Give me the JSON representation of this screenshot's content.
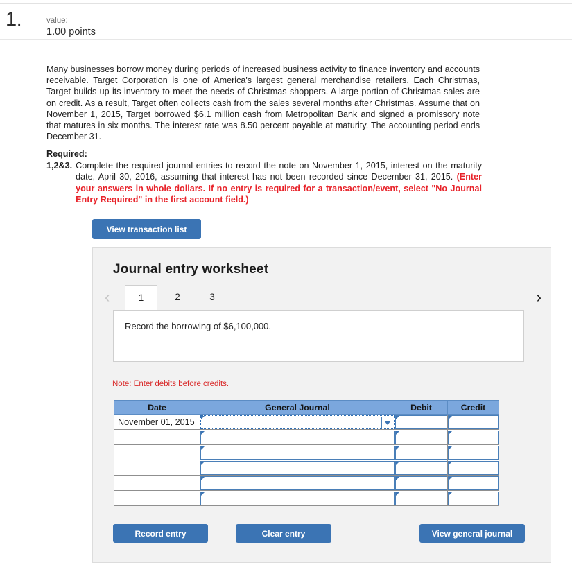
{
  "question": {
    "number": "1.",
    "value_label": "value:",
    "points": "1.00 points"
  },
  "prose": "Many businesses borrow money during periods of increased business activity to finance inventory and accounts receivable. Target Corporation is one of America's largest general merchandise retailers. Each Christmas, Target builds up its inventory to meet the needs of Christmas shoppers. A large portion of Christmas sales are on credit. As a result, Target often collects cash from the sales several months after Christmas. Assume that on November 1, 2015, Target borrowed $6.1 million cash from Metropolitan Bank and signed a promissory note that matures in six months. The interest rate was 8.50 percent payable at maturity. The accounting period ends December 31.",
  "required": {
    "title": "Required:",
    "item_number": "1,2&3.",
    "item_text": "Complete the required journal entries to record the note on November 1, 2015, interest on the maturity date, April 30, 2016, assuming that interest has not been recorded since December 31, 2015. ",
    "item_emphasis": "(Enter your answers in whole dollars. If no entry is required for a transaction/event, select \"No Journal Entry Required\" in the first account field.)",
    "emphasis_color": "#e8232a"
  },
  "buttons": {
    "view_transaction_list": "View transaction list",
    "record_entry": "Record entry",
    "clear_entry": "Clear entry",
    "view_general_journal": "View general journal",
    "color": "#3b74b4"
  },
  "worksheet": {
    "title": "Journal entry worksheet",
    "prev_chevron": "‹",
    "next_chevron": "›",
    "tabs": [
      {
        "label": "1",
        "active": true
      },
      {
        "label": "2",
        "active": false
      },
      {
        "label": "3",
        "active": false
      }
    ],
    "instruction": "Record the borrowing of $6,100,000.",
    "note": "Note: Enter debits before credits.",
    "note_color": "#d92b2b"
  },
  "journal_table": {
    "headers": [
      "Date",
      "General Journal",
      "Debit",
      "Credit"
    ],
    "header_bg": "#7ba7dd",
    "rows": [
      {
        "date": "November 01, 2015",
        "general_journal": "",
        "debit": "",
        "credit": "",
        "focused": true
      },
      {
        "date": "",
        "general_journal": "",
        "debit": "",
        "credit": "",
        "focused": false
      },
      {
        "date": "",
        "general_journal": "",
        "debit": "",
        "credit": "",
        "focused": false
      },
      {
        "date": "",
        "general_journal": "",
        "debit": "",
        "credit": "",
        "focused": false
      },
      {
        "date": "",
        "general_journal": "",
        "debit": "",
        "credit": "",
        "focused": false
      },
      {
        "date": "",
        "general_journal": "",
        "debit": "",
        "credit": "",
        "focused": false
      }
    ]
  }
}
